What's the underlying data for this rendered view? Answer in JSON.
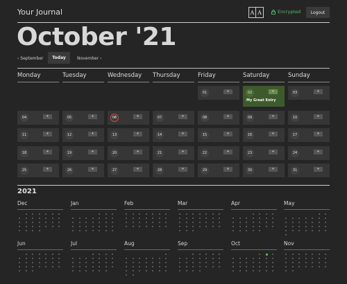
{
  "header": {
    "app_title": "Your Journal",
    "font_toggle": [
      "A",
      "A"
    ],
    "encrypted_label": "Encrypted",
    "logout_label": "Logout"
  },
  "month_title": "October '21",
  "nav": {
    "prev_label": "‹ September",
    "today_label": "Today",
    "next_label": "November ›"
  },
  "weekdays": [
    "Monday",
    "Tuesday",
    "Wednesday",
    "Thursday",
    "Friday",
    "Saturday",
    "Sunday"
  ],
  "days": [
    "01",
    "02",
    "03",
    "04",
    "05",
    "06",
    "07",
    "08",
    "09",
    "10",
    "11",
    "12",
    "13",
    "14",
    "15",
    "16",
    "17",
    "18",
    "19",
    "20",
    "21",
    "22",
    "23",
    "24",
    "25",
    "26",
    "27",
    "28",
    "29",
    "30",
    "31"
  ],
  "add_label": "+",
  "today_day": "06",
  "entries": {
    "02": "My Great Entry"
  },
  "year": "2021",
  "mini_months": [
    "Dec",
    "Jan",
    "Feb",
    "Mar",
    "Apr",
    "May",
    "Jun",
    "Jul",
    "Aug",
    "Sep",
    "Oct",
    "Nov"
  ],
  "colors": {
    "entry": "#3e5a2c",
    "today_ring": "#d04848",
    "encrypted": "#5cbc6a"
  }
}
